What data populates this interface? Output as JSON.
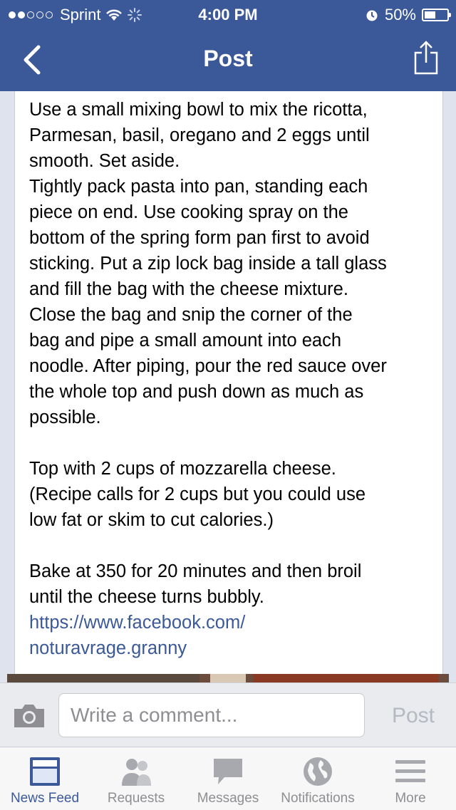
{
  "status_bar": {
    "carrier": "Sprint",
    "signal_dots_filled": 2,
    "signal_dots_total": 5,
    "time": "4:00 PM",
    "battery": "50%",
    "battery_level": 0.5
  },
  "nav": {
    "title": "Post",
    "back_icon": "chevron-left-icon",
    "share_icon": "share-icon"
  },
  "post": {
    "text": "Use a small mixing bowl to mix the ricotta,\nParmesan, basil, oregano and 2 eggs until\nsmooth. Set aside.\nTightly pack pasta into pan, standing each\npiece on end. Use cooking spray on the\nbottom of the spring form pan first to avoid\nsticking. Put a zip lock bag inside a tall glass\nand fill the bag with the cheese mixture.\nClose the bag and snip the corner of the\nbag and pipe a small amount into each\nnoodle. After piping, pour the red sauce over\nthe whole top and push down as much as\npossible.\n\nTop with 2 cups of mozzarella cheese.\n(Recipe calls for 2 cups but you could use\nlow fat or skim to cut calories.)\n\nBake at 350 for 20 minutes and then broil\nuntil the cheese turns bubbly.",
    "link_line1": "https://www.facebook.com/",
    "link_line2": "noturavrage.granny"
  },
  "comment": {
    "placeholder": "Write a comment...",
    "post_label": "Post",
    "camera_icon": "camera-icon"
  },
  "tabs": [
    {
      "label": "News Feed",
      "icon": "news-feed-icon",
      "active": true
    },
    {
      "label": "Requests",
      "icon": "friend-requests-icon",
      "active": false
    },
    {
      "label": "Messages",
      "icon": "messages-icon",
      "active": false
    },
    {
      "label": "Notifications",
      "icon": "globe-icon",
      "active": false
    },
    {
      "label": "More",
      "icon": "menu-icon",
      "active": false
    }
  ],
  "colors": {
    "brand": "#3b5998",
    "inactive": "#8e8e93"
  }
}
